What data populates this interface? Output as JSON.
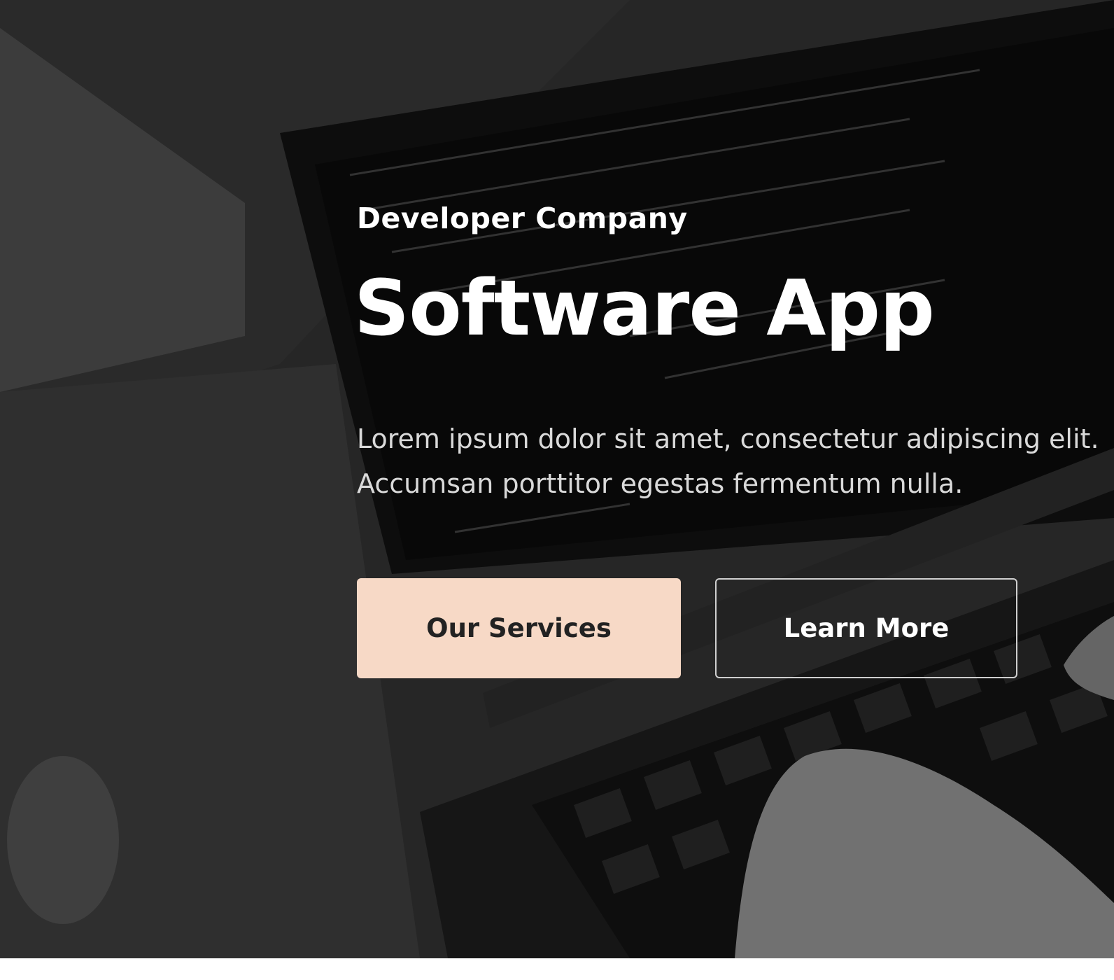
{
  "hero": {
    "subtitle": "Developer Company",
    "title": "Software App",
    "description_line1": "Lorem ipsum dolor sit amet, consectetur adipiscing elit.",
    "description_line2": "Accumsan porttitor egestas fermentum nulla.",
    "primary_button_label": "Our Services",
    "secondary_button_label": "Learn More",
    "background_image": "laptop-coding-photo",
    "colors": {
      "primary_button_bg": "#f7d9c6",
      "primary_button_text": "#222222",
      "heading_text": "#ffffff",
      "body_text": "#d9d9d9"
    }
  }
}
